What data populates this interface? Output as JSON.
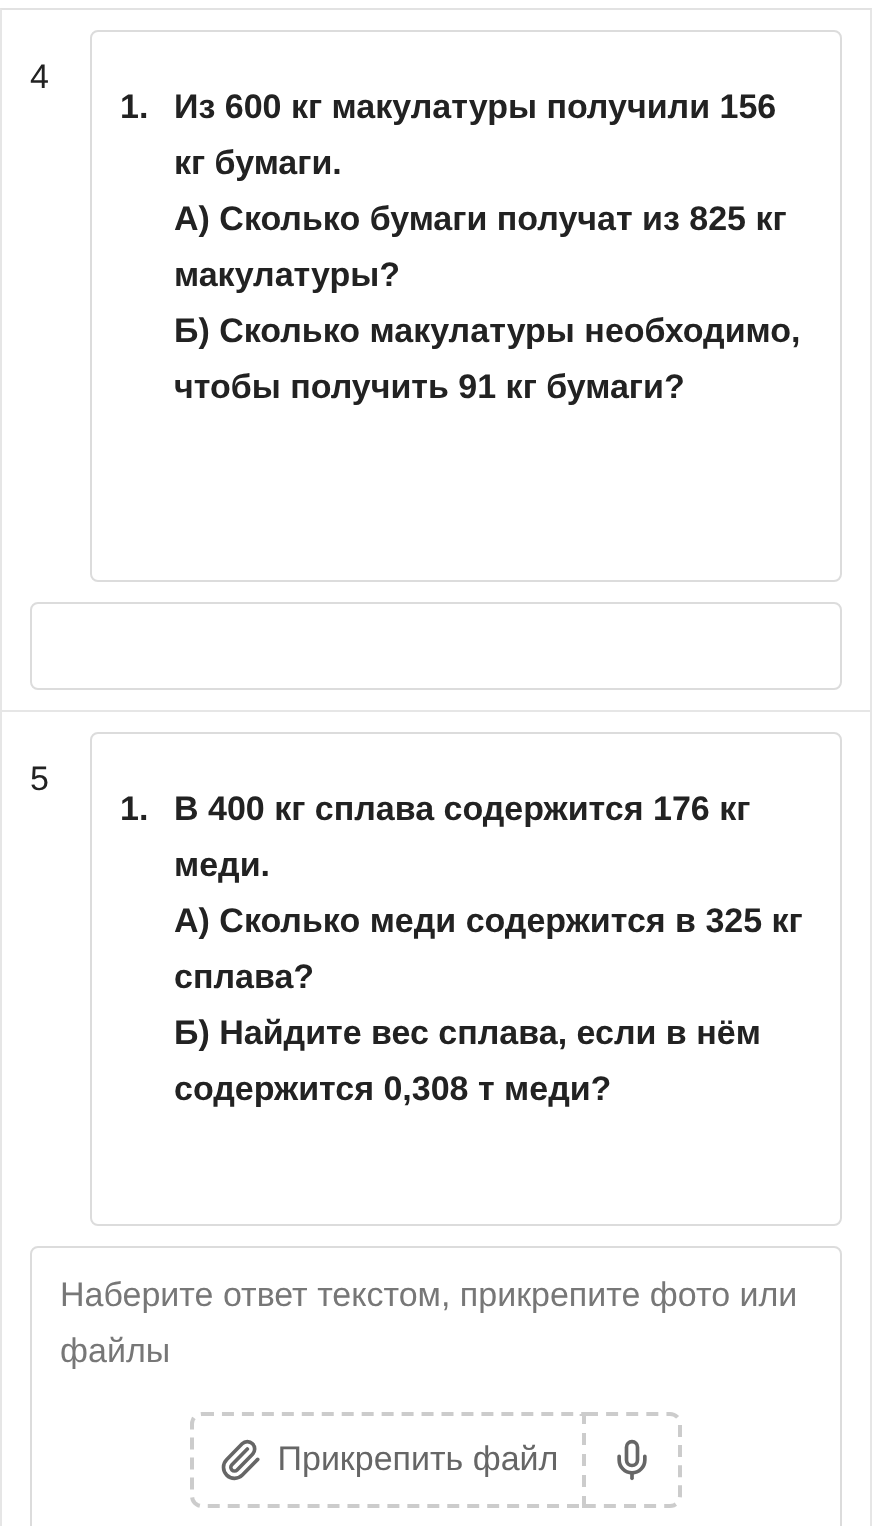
{
  "tasks": [
    {
      "number": "4",
      "items": [
        {
          "marker": "1.",
          "lines": [
            "Из 600 кг макулатуры получили 156 кг бумаги.",
            "А) Сколько бумаги получат из 825 кг макулатуры?",
            "Б) Сколько макулатуры необходимо, чтобы получить 91 кг бумаги?"
          ]
        }
      ],
      "answer": {
        "kind": "empty"
      }
    },
    {
      "number": "5",
      "items": [
        {
          "marker": "1.",
          "lines": [
            "В 400 кг сплава содержится 176 кг меди.",
            "А) Сколько меди содержится в 325 кг сплава?",
            "Б) Найдите вес сплава, если в нём содержится 0,308 т меди?"
          ]
        }
      ],
      "answer": {
        "kind": "full",
        "placeholder": "Наберите ответ текстом, прикрепите фото или файлы",
        "attach_label": "Прикрепить файл"
      }
    }
  ]
}
